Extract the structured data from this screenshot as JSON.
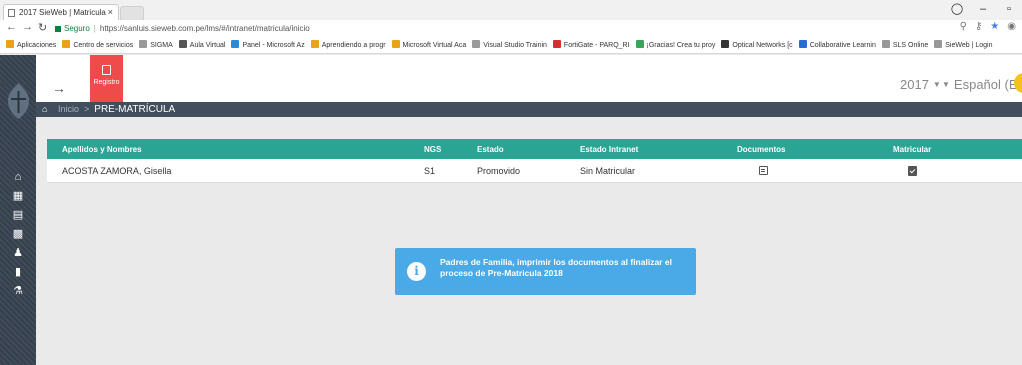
{
  "browser": {
    "tab_title": "2017 SieWeb | Matricula",
    "tab_close": "×",
    "url_secure_label": "Seguro",
    "url": "https://sanluis.sieweb.com.pe/lms/#/intranet/matricula/inicio",
    "bookmarks": [
      {
        "label": "Aplicaciones",
        "color": "#e8a317"
      },
      {
        "label": "Centro de servicios",
        "color": "#e8a317"
      },
      {
        "label": "SIGMA",
        "color": "#999999"
      },
      {
        "label": "Aula Virtual",
        "color": "#555555"
      },
      {
        "label": "Panel - Microsoft Az",
        "color": "#2a8ad6"
      },
      {
        "label": "Aprendiendo a progr",
        "color": "#e8a317"
      },
      {
        "label": "Microsoft Virtual Aca",
        "color": "#e8a317"
      },
      {
        "label": "Visual Studio Trainin",
        "color": "#999999"
      },
      {
        "label": "FortiGate - PARQ_RI",
        "color": "#d03030"
      },
      {
        "label": "¡Gracias! Crea tu proy",
        "color": "#3aa55a"
      },
      {
        "label": "Optical Networks [c",
        "color": "#333333"
      },
      {
        "label": "Collaborative Learnin",
        "color": "#2a6ad6"
      },
      {
        "label": "SLS Online",
        "color": "#999999"
      },
      {
        "label": "SieWeb | Login",
        "color": "#999999"
      }
    ]
  },
  "header": {
    "register_label": "Registro",
    "year": "2017",
    "language": "Español (ES)"
  },
  "breadcrumb": {
    "home": "Inicio",
    "current": "PRE-MATRÍCULA"
  },
  "table": {
    "columns": [
      "Apellidos y Nombres",
      "NGS",
      "Estado",
      "Estado Intranet",
      "Documentos",
      "Matricular"
    ],
    "rows": [
      {
        "name": "ACOSTA ZAMORA, Gisella",
        "ngs": "S1",
        "estado": "Promovido",
        "estado_intranet": "Sin Matricular"
      }
    ]
  },
  "alert": {
    "icon": "i",
    "message": "Padres de Familia, imprimir los documentos al finalizar el proceso de Pre-Matricula 2018"
  },
  "colors": {
    "table_header": "#2aa593",
    "alert": "#4aaae8",
    "register_button": "#ef4b4b",
    "sidebar": "#35404e"
  }
}
